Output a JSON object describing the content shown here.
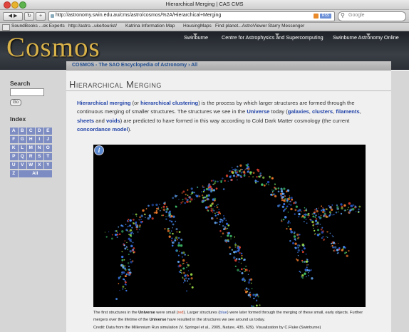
{
  "browser": {
    "window_title": "Hierarchical Merging | CAS CMS",
    "back_forward": "◀ ▶",
    "reload": "↻",
    "add": "+",
    "url": "http://astronomy.swin.edu.au/cms/astro/cosmos/%2A/Hierarchical+Merging",
    "rss": "RSS",
    "search_placeholder": "Google",
    "bookmarks": [
      "SoundBooks ...ok Experts",
      "http://astro...uke/tourist/",
      "Katrina Information Map",
      "HousingMaps",
      "Find planet...AstroViewer",
      "Starry Messenger"
    ]
  },
  "site": {
    "logo": "Cosmos",
    "nav": [
      "Swinburne",
      "Centre for Astrophysics and Supercomputing",
      "Swinburne Astronomy Online"
    ],
    "breadcrumb": "COSMOS - The SAO Encyclopedia of Astronomy › All"
  },
  "sidebar": {
    "search_label": "Search",
    "go_label": "Go",
    "index_label": "Index",
    "letters": [
      "A",
      "B",
      "C",
      "D",
      "E",
      "F",
      "G",
      "H",
      "I",
      "J",
      "K",
      "L",
      "M",
      "N",
      "O",
      "P",
      "Q",
      "R",
      "S",
      "T",
      "U",
      "V",
      "W",
      "X",
      "Y",
      "Z"
    ],
    "all_label": "All"
  },
  "article": {
    "title": "Hierarchical Merging",
    "intro": {
      "term1": "Hierarchical merging",
      "t1": " (or ",
      "term2": "hierarchical clustering",
      "t2": ") is the process by which larger structures are formed through the continuous merging of smaller structures. The structures we see in the ",
      "term3": "Universe",
      "t3": " today (",
      "term4": "galaxies",
      "t4": ", ",
      "term5": "clusters",
      "t5": ", ",
      "term6": "filaments",
      "t6": ", ",
      "term7": "sheets",
      "t7": " and ",
      "term8": "voids",
      "t8": ") are predicted to have formed in this way according to Cold Dark Matter cosmology (the current ",
      "term9": "concordance model",
      "t9": ")."
    },
    "caption": {
      "c1": "The first structures in the ",
      "universe1": "Universe",
      "c2": " were small (",
      "red": "red",
      "c3": "). Larger structures (",
      "blue": "blue",
      "c4": ") were later formed through the merging of these small, early objects. Further mergers over the lifetime of the ",
      "universe2": "Universe",
      "c5": " have resulted in the structures we see around us today.",
      "credit": "Credit: Data from the Millennium Run simulation (V. Springel et al., 2005, Nature, 435, 629). Visualization by C.Fluke (Swinburne)"
    }
  }
}
